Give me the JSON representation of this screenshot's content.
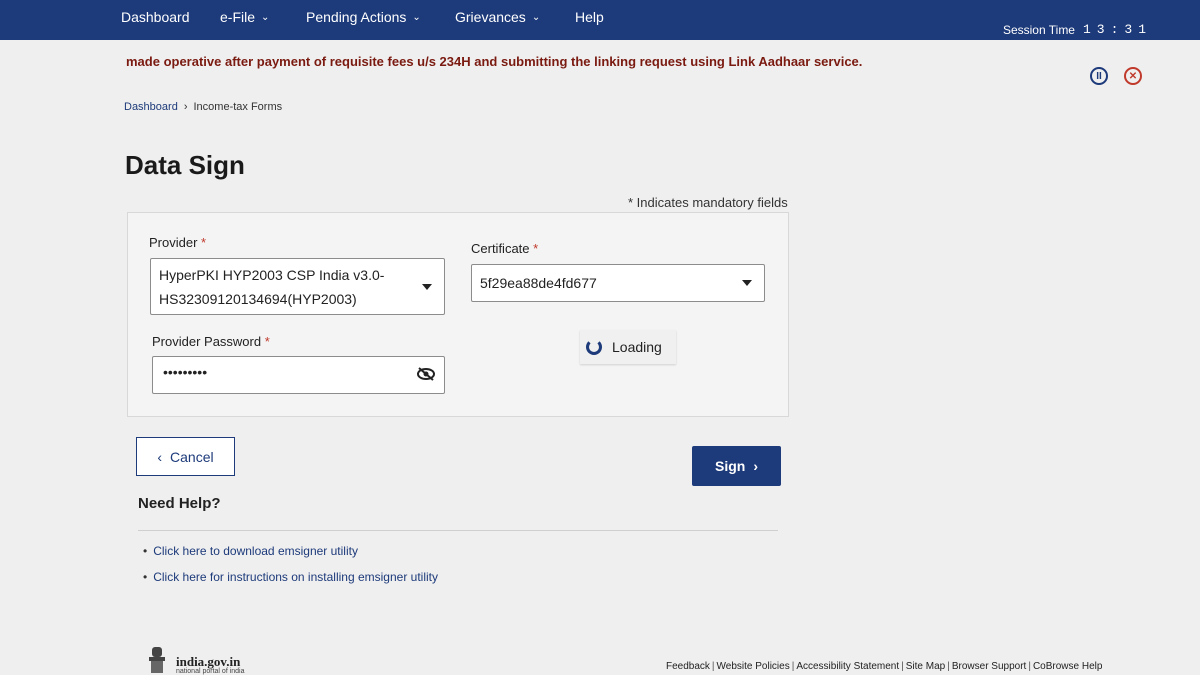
{
  "nav": {
    "items": [
      {
        "label": "Dashboard",
        "has_dropdown": false
      },
      {
        "label": "e-File",
        "has_dropdown": true
      },
      {
        "label": "Pending Actions",
        "has_dropdown": true
      },
      {
        "label": "Grievances",
        "has_dropdown": true
      },
      {
        "label": "Help",
        "has_dropdown": false
      }
    ],
    "session_label": "Session Time",
    "session_value": "13:31"
  },
  "alert": {
    "text": "made operative after payment of requisite fees u/s 234H and submitting the linking request using Link Aadhaar service."
  },
  "breadcrumb": {
    "items": [
      "Dashboard",
      "Income-tax Forms"
    ],
    "separator": "›"
  },
  "page": {
    "title": "Data Sign",
    "mandatory_note": "* Indicates mandatory fields"
  },
  "form": {
    "provider": {
      "label": "Provider",
      "required": "*",
      "value_line1": "HyperPKI HYP2003 CSP India v3.0-",
      "value_line2": "HS32309120134694(HYP2003)"
    },
    "certificate": {
      "label": "Certificate",
      "required": "*",
      "value": "5f29ea88de4fd677"
    },
    "password": {
      "label": "Provider Password",
      "required": "*",
      "value": "•••••••••"
    },
    "loading_text": "Loading"
  },
  "buttons": {
    "cancel": "Cancel",
    "sign": "Sign"
  },
  "help": {
    "title": "Need Help?",
    "links": [
      "Click here to download emsigner utility",
      "Click here for instructions on installing emsigner utility"
    ]
  },
  "footer": {
    "brand": "india.gov.in",
    "brand_sub": "national portal of india",
    "links": [
      "Feedback",
      "Website Policies",
      "Accessibility Statement",
      "Site Map",
      "Browser Support",
      "CoBrowse Help"
    ]
  },
  "colors": {
    "nav_bg": "#1d3a7a",
    "primary": "#1d3a7a",
    "alert_text": "#7a1a10",
    "required": "#c0392b"
  }
}
